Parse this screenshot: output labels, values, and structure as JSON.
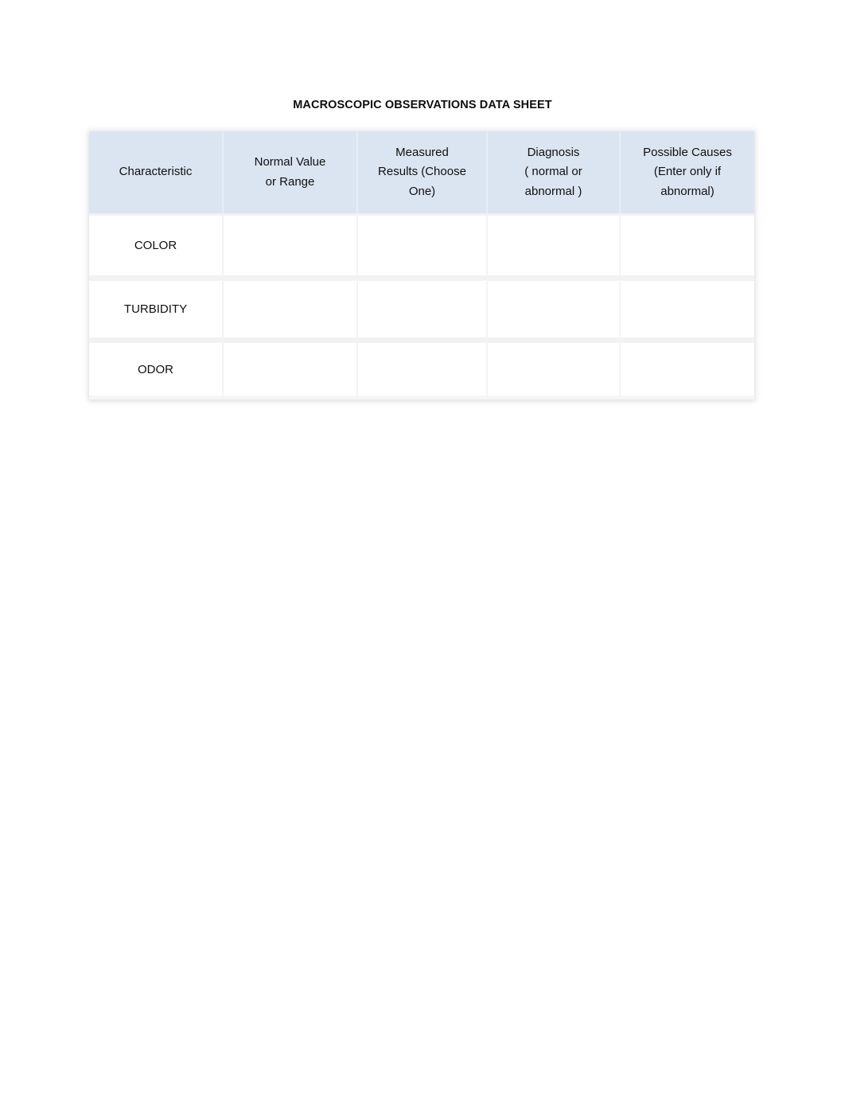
{
  "document": {
    "title": "MACROSCOPIC OBSERVATIONS DATA SHEET",
    "background_color": "#ffffff",
    "text_color": "#101010"
  },
  "table": {
    "header_background_color": "#dbe5f1",
    "row_background_color": "#ffffff",
    "grid_color": "#f2f2f2",
    "columns": [
      {
        "label": "Characteristic"
      },
      {
        "label": "Normal Value\nor Range"
      },
      {
        "label": "Measured\nResults (Choose\nOne)"
      },
      {
        "label": "Diagnosis\n( normal or\nabnormal )"
      },
      {
        "label": "Possible Causes\n(Enter only if\nabnormal)"
      }
    ],
    "column_labels": {
      "characteristic": "Characteristic",
      "normal_value_line1": "Normal Value",
      "normal_value_line2": "or Range",
      "measured_results_line1": "Measured",
      "measured_results_line2": "Results (Choose",
      "measured_results_line3": "One)",
      "diagnosis_line1": "Diagnosis",
      "diagnosis_line2": "( normal or",
      "diagnosis_line3": "abnormal )",
      "possible_causes_line1": "Possible Causes",
      "possible_causes_line2": "(Enter only if",
      "possible_causes_line3": "abnormal)"
    },
    "rows": [
      {
        "characteristic": "COLOR",
        "normal_value": "",
        "measured_results": "",
        "diagnosis": "",
        "possible_causes": ""
      },
      {
        "characteristic": "TURBIDITY",
        "normal_value": "",
        "measured_results": "",
        "diagnosis": "",
        "possible_causes": ""
      },
      {
        "characteristic": "ODOR",
        "normal_value": "",
        "measured_results": "",
        "diagnosis": "",
        "possible_causes": ""
      }
    ]
  }
}
